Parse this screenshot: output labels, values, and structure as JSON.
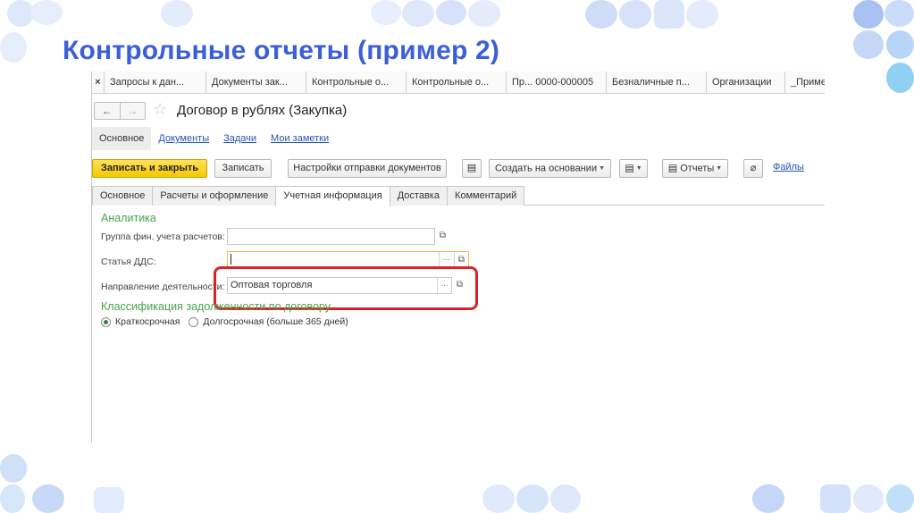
{
  "slide": {
    "title": "Контрольные отчеты (пример 2)",
    "colors": {
      "title": "#3b5fd9",
      "highlight": "#d9232b",
      "accent_yellow": "#f5c800"
    }
  },
  "window_tabs": [
    {
      "label": "Запросы к дан..."
    },
    {
      "label": "Документы зак..."
    },
    {
      "label": "Контрольные о..."
    },
    {
      "label": "Контрольные о..."
    },
    {
      "label": "Пр... 0000-000005"
    },
    {
      "label": "Безналичные п..."
    },
    {
      "label": "Организации"
    },
    {
      "label": "_Приме"
    }
  ],
  "window_tab_close": "×",
  "form": {
    "title": "Договор в рублях (Закупка)",
    "nav_back": "←",
    "nav_forward": "→",
    "star_icon": "☆",
    "sub_tabs": [
      {
        "label": "Основное",
        "active": true
      },
      {
        "label": "Документы",
        "active": false
      },
      {
        "label": "Задачи",
        "active": false
      },
      {
        "label": "Мои заметки",
        "active": false
      }
    ]
  },
  "toolbar": {
    "save_close": "Записать и закрыть",
    "save": "Записать",
    "send_settings": "Настройки отправки документов",
    "list_icon": "▤",
    "create_based": "Создать на основании",
    "doc_icon": "▤",
    "reports_icon": "▤",
    "reports": "Отчеты",
    "clip_icon": "⌀",
    "files": "Файлы"
  },
  "page_tabs": [
    {
      "label": "Основное",
      "active": false
    },
    {
      "label": "Расчеты и оформление",
      "active": false
    },
    {
      "label": "Учетная информация",
      "active": true
    },
    {
      "label": "Доставка",
      "active": false
    },
    {
      "label": "Комментарий",
      "active": false
    }
  ],
  "analytics": {
    "group_title": "Аналитика",
    "fin_group_label": "Группа фин. учета расчетов:",
    "fin_group_value": "",
    "dds_label": "Статья ДДС:",
    "dds_value": "",
    "activity_label": "Направление деятельности:",
    "activity_value": "Оптовая торговля",
    "dots": "...",
    "open_icon": "⧉"
  },
  "classification": {
    "group_title": "Классификация задолженности по договору",
    "options": [
      {
        "label": "Краткосрочная",
        "selected": true
      },
      {
        "label": "Долгосрочная (больше 365 дней)",
        "selected": false
      }
    ]
  }
}
